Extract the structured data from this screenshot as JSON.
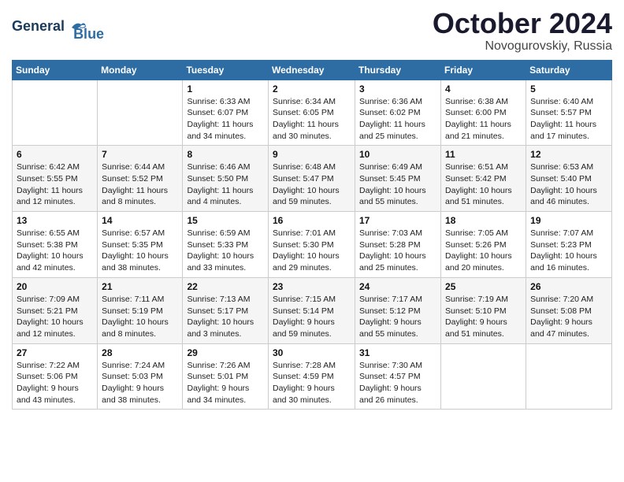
{
  "logo": {
    "line1": "General",
    "line2": "Blue"
  },
  "title": "October 2024",
  "location": "Novogurovskiy, Russia",
  "days_header": [
    "Sunday",
    "Monday",
    "Tuesday",
    "Wednesday",
    "Thursday",
    "Friday",
    "Saturday"
  ],
  "weeks": [
    [
      {
        "day": "",
        "info": ""
      },
      {
        "day": "",
        "info": ""
      },
      {
        "day": "1",
        "info": "Sunrise: 6:33 AM\nSunset: 6:07 PM\nDaylight: 11 hours\nand 34 minutes."
      },
      {
        "day": "2",
        "info": "Sunrise: 6:34 AM\nSunset: 6:05 PM\nDaylight: 11 hours\nand 30 minutes."
      },
      {
        "day": "3",
        "info": "Sunrise: 6:36 AM\nSunset: 6:02 PM\nDaylight: 11 hours\nand 25 minutes."
      },
      {
        "day": "4",
        "info": "Sunrise: 6:38 AM\nSunset: 6:00 PM\nDaylight: 11 hours\nand 21 minutes."
      },
      {
        "day": "5",
        "info": "Sunrise: 6:40 AM\nSunset: 5:57 PM\nDaylight: 11 hours\nand 17 minutes."
      }
    ],
    [
      {
        "day": "6",
        "info": "Sunrise: 6:42 AM\nSunset: 5:55 PM\nDaylight: 11 hours\nand 12 minutes."
      },
      {
        "day": "7",
        "info": "Sunrise: 6:44 AM\nSunset: 5:52 PM\nDaylight: 11 hours\nand 8 minutes."
      },
      {
        "day": "8",
        "info": "Sunrise: 6:46 AM\nSunset: 5:50 PM\nDaylight: 11 hours\nand 4 minutes."
      },
      {
        "day": "9",
        "info": "Sunrise: 6:48 AM\nSunset: 5:47 PM\nDaylight: 10 hours\nand 59 minutes."
      },
      {
        "day": "10",
        "info": "Sunrise: 6:49 AM\nSunset: 5:45 PM\nDaylight: 10 hours\nand 55 minutes."
      },
      {
        "day": "11",
        "info": "Sunrise: 6:51 AM\nSunset: 5:42 PM\nDaylight: 10 hours\nand 51 minutes."
      },
      {
        "day": "12",
        "info": "Sunrise: 6:53 AM\nSunset: 5:40 PM\nDaylight: 10 hours\nand 46 minutes."
      }
    ],
    [
      {
        "day": "13",
        "info": "Sunrise: 6:55 AM\nSunset: 5:38 PM\nDaylight: 10 hours\nand 42 minutes."
      },
      {
        "day": "14",
        "info": "Sunrise: 6:57 AM\nSunset: 5:35 PM\nDaylight: 10 hours\nand 38 minutes."
      },
      {
        "day": "15",
        "info": "Sunrise: 6:59 AM\nSunset: 5:33 PM\nDaylight: 10 hours\nand 33 minutes."
      },
      {
        "day": "16",
        "info": "Sunrise: 7:01 AM\nSunset: 5:30 PM\nDaylight: 10 hours\nand 29 minutes."
      },
      {
        "day": "17",
        "info": "Sunrise: 7:03 AM\nSunset: 5:28 PM\nDaylight: 10 hours\nand 25 minutes."
      },
      {
        "day": "18",
        "info": "Sunrise: 7:05 AM\nSunset: 5:26 PM\nDaylight: 10 hours\nand 20 minutes."
      },
      {
        "day": "19",
        "info": "Sunrise: 7:07 AM\nSunset: 5:23 PM\nDaylight: 10 hours\nand 16 minutes."
      }
    ],
    [
      {
        "day": "20",
        "info": "Sunrise: 7:09 AM\nSunset: 5:21 PM\nDaylight: 10 hours\nand 12 minutes."
      },
      {
        "day": "21",
        "info": "Sunrise: 7:11 AM\nSunset: 5:19 PM\nDaylight: 10 hours\nand 8 minutes."
      },
      {
        "day": "22",
        "info": "Sunrise: 7:13 AM\nSunset: 5:17 PM\nDaylight: 10 hours\nand 3 minutes."
      },
      {
        "day": "23",
        "info": "Sunrise: 7:15 AM\nSunset: 5:14 PM\nDaylight: 9 hours\nand 59 minutes."
      },
      {
        "day": "24",
        "info": "Sunrise: 7:17 AM\nSunset: 5:12 PM\nDaylight: 9 hours\nand 55 minutes."
      },
      {
        "day": "25",
        "info": "Sunrise: 7:19 AM\nSunset: 5:10 PM\nDaylight: 9 hours\nand 51 minutes."
      },
      {
        "day": "26",
        "info": "Sunrise: 7:20 AM\nSunset: 5:08 PM\nDaylight: 9 hours\nand 47 minutes."
      }
    ],
    [
      {
        "day": "27",
        "info": "Sunrise: 7:22 AM\nSunset: 5:06 PM\nDaylight: 9 hours\nand 43 minutes."
      },
      {
        "day": "28",
        "info": "Sunrise: 7:24 AM\nSunset: 5:03 PM\nDaylight: 9 hours\nand 38 minutes."
      },
      {
        "day": "29",
        "info": "Sunrise: 7:26 AM\nSunset: 5:01 PM\nDaylight: 9 hours\nand 34 minutes."
      },
      {
        "day": "30",
        "info": "Sunrise: 7:28 AM\nSunset: 4:59 PM\nDaylight: 9 hours\nand 30 minutes."
      },
      {
        "day": "31",
        "info": "Sunrise: 7:30 AM\nSunset: 4:57 PM\nDaylight: 9 hours\nand 26 minutes."
      },
      {
        "day": "",
        "info": ""
      },
      {
        "day": "",
        "info": ""
      }
    ]
  ]
}
